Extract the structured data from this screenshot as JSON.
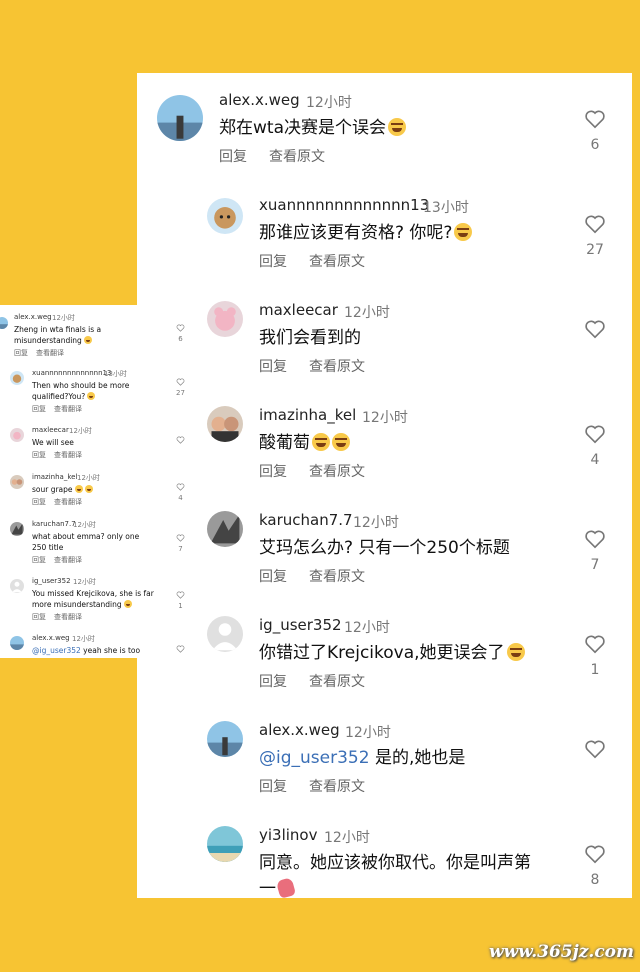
{
  "labels": {
    "reply": "回复",
    "translate": "查看原文"
  },
  "mini_labels": {
    "reply": "回复",
    "translate": "查看翻译"
  },
  "comments": [
    {
      "user": "alex.x.weg",
      "time": "12小时",
      "text": "郑在wta决赛是个误会",
      "likes": "6"
    },
    {
      "user": "xuannnnnnnnnnnnn13",
      "time": "13小时",
      "text": "那谁应该更有资格? 你呢?",
      "likes": "27"
    },
    {
      "user": "maxleecar",
      "time": "12小时",
      "text": "我们会看到的",
      "likes": ""
    },
    {
      "user": "imazinha_kel",
      "time": "12小时",
      "text": "酸葡萄",
      "likes": "4"
    },
    {
      "user": "karuchan7.7",
      "time": "12小时",
      "text": "艾玛怎么办? 只有一个250个标题",
      "likes": "7"
    },
    {
      "user": "ig_user352",
      "time": "12小时",
      "text": "你错过了Krejcikova,她更误会了",
      "likes": "1"
    },
    {
      "user": "alex.x.weg",
      "time": "12小时",
      "mention": "@ig_user352",
      "text": " 是的,她也是",
      "likes": ""
    },
    {
      "user": "yi3linov",
      "time": "12小时",
      "text": "同意。她应该被你取代。你是叫声第",
      "text2": "一",
      "likes": "8"
    }
  ],
  "mini_comments": [
    {
      "user": "alex.x.weg",
      "time": "12小时",
      "text": "Zheng in wta finals is a misunderstanding",
      "likes": "6"
    },
    {
      "user": "xuannnnnnnnnnnnn13",
      "time": "13小时",
      "text": "Then who should be more qualified?You?",
      "likes": "27"
    },
    {
      "user": "maxleecar",
      "time": "12小时",
      "text": "We will see",
      "likes": ""
    },
    {
      "user": "imazinha_kel",
      "time": "12小时",
      "text": "sour grape",
      "likes": "4"
    },
    {
      "user": "karuchan7.7",
      "time": "12小时",
      "text": "what about emma? only one 250 title",
      "likes": "7"
    },
    {
      "user": "ig_user352",
      "time": "12小时",
      "text": "You missed Krejcikova, she is far more misunderstanding",
      "likes": "1"
    },
    {
      "user": "alex.x.weg",
      "time": "12小时",
      "mention": "@ig_user352",
      "text": " yeah she is too",
      "likes": ""
    }
  ],
  "watermark": "www.365jz.com",
  "colors": {
    "background": "#f7c433",
    "mention": "#3b6fb6"
  }
}
